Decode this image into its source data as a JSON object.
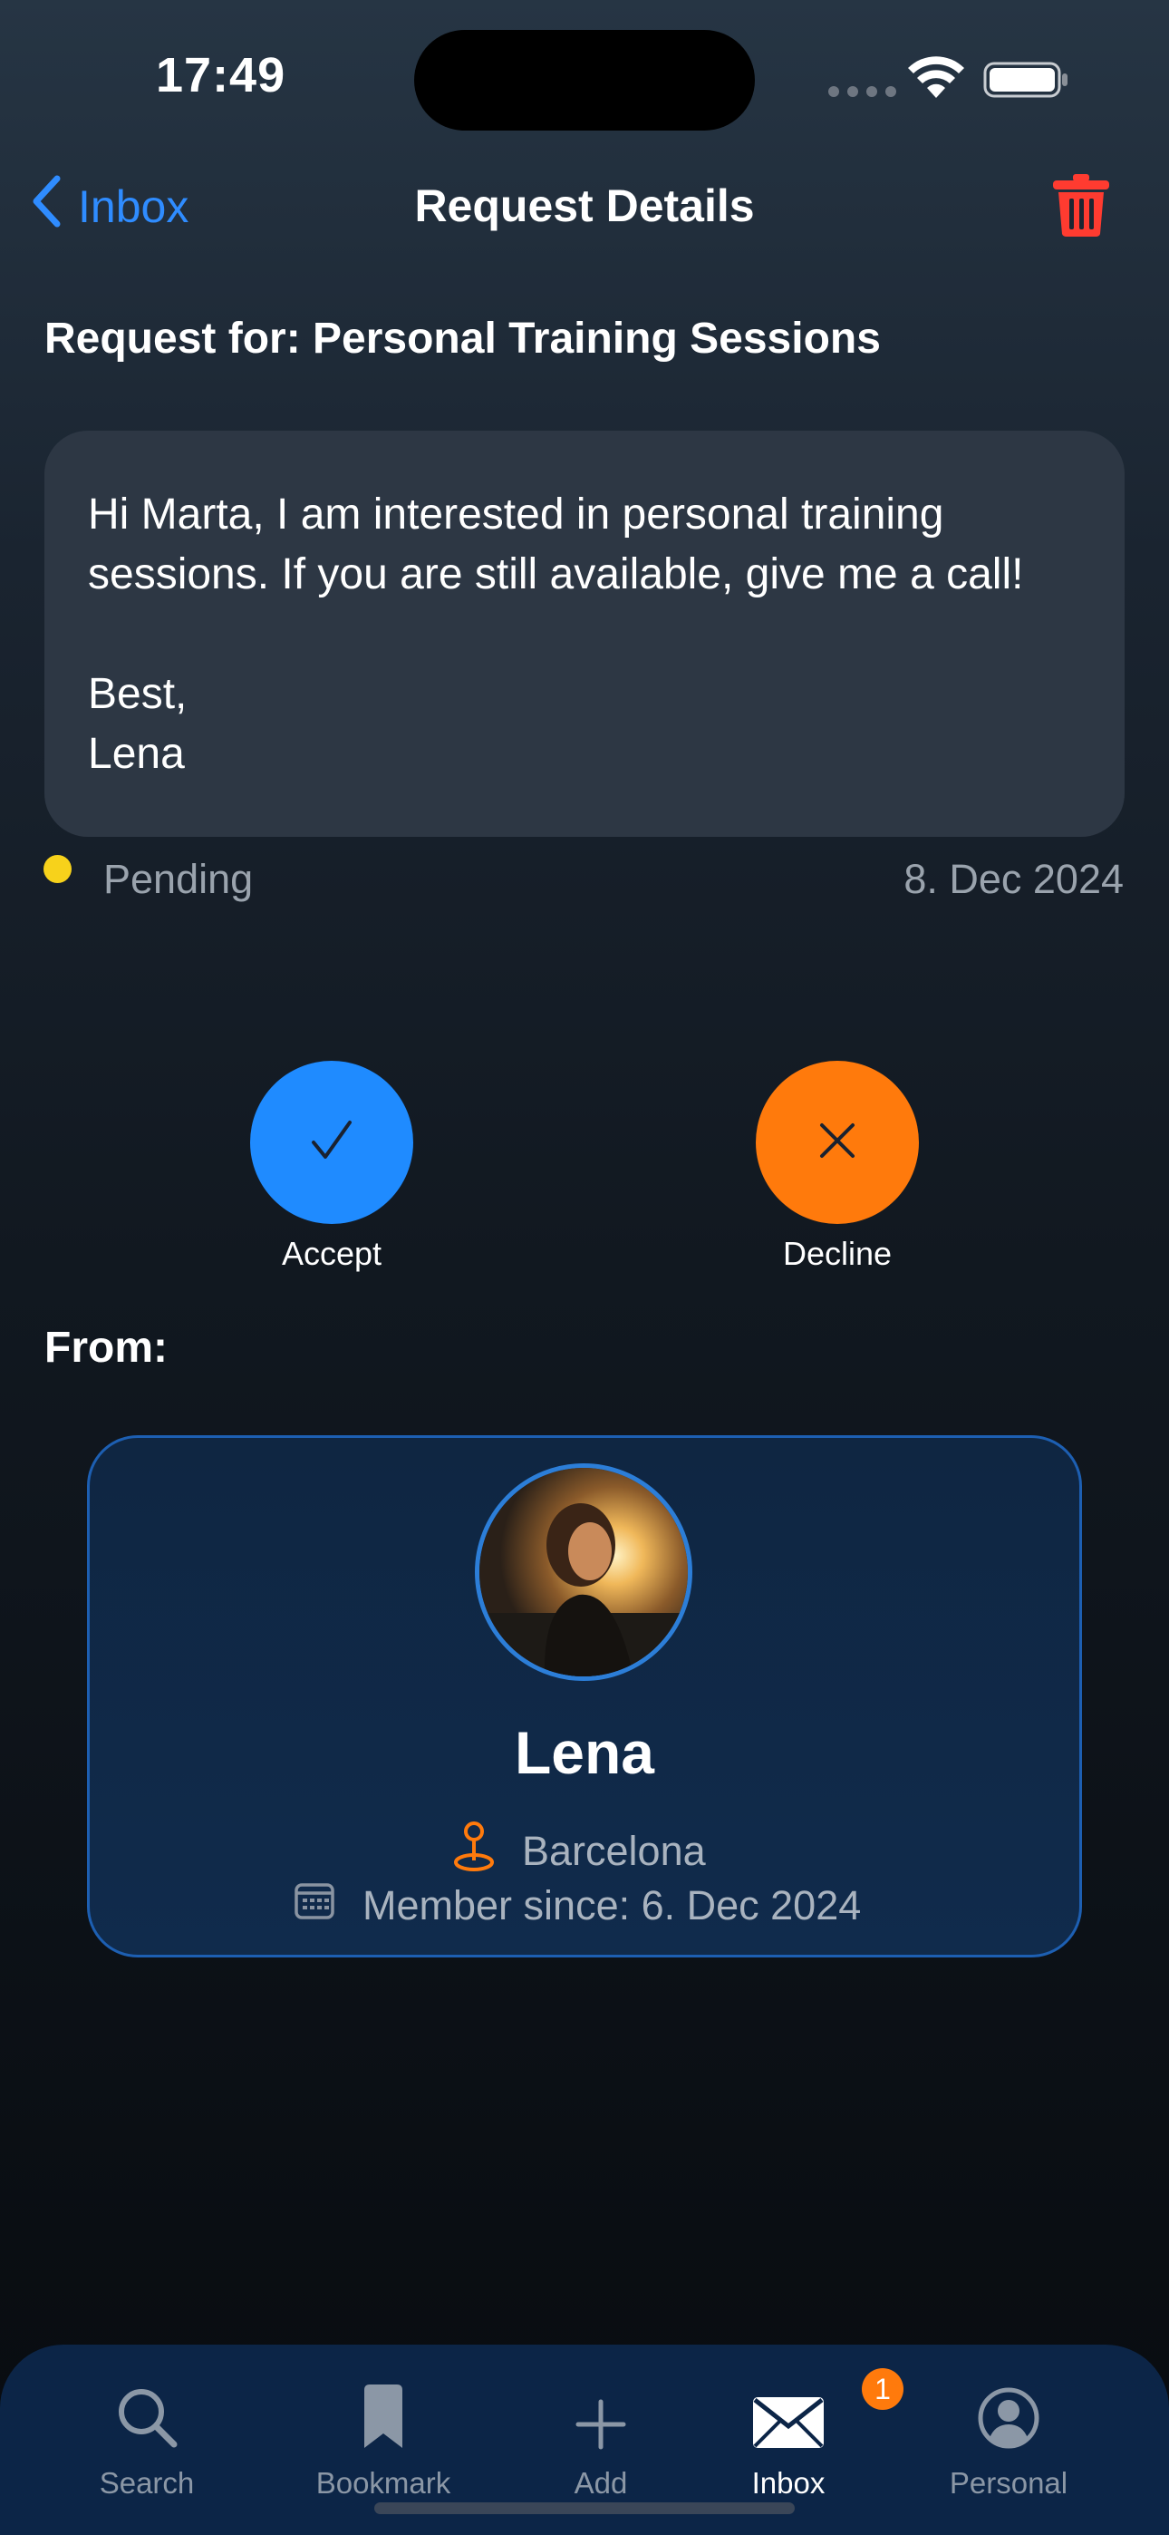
{
  "status_bar": {
    "time": "17:49"
  },
  "nav": {
    "back_label": "Inbox",
    "title": "Request Details"
  },
  "request": {
    "heading": "Request for: Personal Training Sessions",
    "message": "Hi Marta, I am interested in personal training sessions. If you are still available, give me a call!\n\nBest,\nLena",
    "status": "Pending",
    "status_color": "#f7d21b",
    "date": "8. Dec 2024"
  },
  "actions": {
    "accept_label": "Accept",
    "decline_label": "Decline",
    "accept_color": "#1f8bff",
    "decline_color": "#ff7a0c"
  },
  "from": {
    "label": "From:",
    "name": "Lena",
    "location": "Barcelona",
    "member_since": "Member since: 6. Dec 2024"
  },
  "tab_bar": {
    "tabs": [
      {
        "label": "Search",
        "icon": "search-icon"
      },
      {
        "label": "Bookmark",
        "icon": "bookmark-icon"
      },
      {
        "label": "Add",
        "icon": "plus-icon"
      },
      {
        "label": "Inbox",
        "icon": "envelope-icon",
        "badge": "1",
        "active": true
      },
      {
        "label": "Personal",
        "icon": "person-icon"
      }
    ]
  },
  "colors": {
    "accent": "#2f8cff",
    "danger": "#ff3b30"
  }
}
